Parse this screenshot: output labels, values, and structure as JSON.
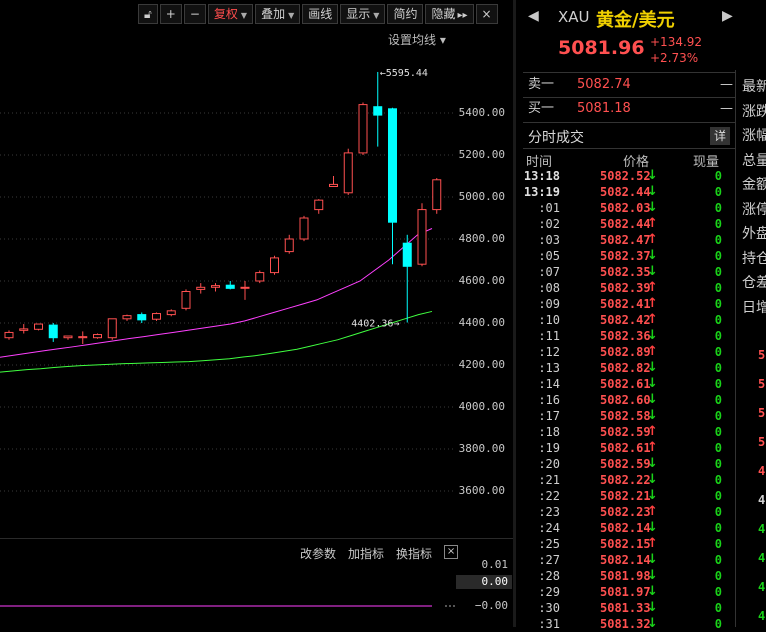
{
  "toolbar": {
    "lock_icon": "lock-icon",
    "plus_label": "+",
    "minus_label": "−",
    "fuquan": "复权",
    "diejia": "叠加",
    "huaxian": "画线",
    "xianshi": "显示",
    "jianyue": "简约",
    "yincang": "隐藏",
    "more": "▸▸",
    "close": "×",
    "active_color": "#ff4d4d"
  },
  "chart": {
    "settings_ma": "设置均线 ▾",
    "high_label": "←5595.44",
    "low_label": "4402.36→",
    "y_ticks": [
      "5400.00",
      "5200.00",
      "5000.00",
      "4800.00",
      "4600.00",
      "4400.00",
      "4200.00",
      "4000.00",
      "3800.00",
      "3600.00"
    ],
    "colors": {
      "up": "#ff5050",
      "down": "#00ffff",
      "ma_short": "#ff40ff",
      "ma_long": "#40ff40"
    }
  },
  "chart_data": {
    "type": "candlestick",
    "y_ticks": [
      5400,
      5200,
      5000,
      4800,
      4600,
      4400,
      4200,
      4000,
      3800,
      3600
    ],
    "candles": [
      {
        "o": 4330,
        "h": 4365,
        "l": 4320,
        "c": 4355
      },
      {
        "o": 4365,
        "h": 4395,
        "l": 4350,
        "c": 4372
      },
      {
        "o": 4370,
        "h": 4395,
        "l": 4365,
        "c": 4395
      },
      {
        "o": 4390,
        "h": 4400,
        "l": 4310,
        "c": 4330
      },
      {
        "o": 4330,
        "h": 4340,
        "l": 4320,
        "c": 4338
      },
      {
        "o": 4330,
        "h": 4360,
        "l": 4300,
        "c": 4335
      },
      {
        "o": 4330,
        "h": 4350,
        "l": 4325,
        "c": 4345
      },
      {
        "o": 4330,
        "h": 4380,
        "l": 4320,
        "c": 4420
      },
      {
        "o": 4420,
        "h": 4440,
        "l": 4410,
        "c": 4435
      },
      {
        "o": 4440,
        "h": 4450,
        "l": 4400,
        "c": 4415
      },
      {
        "o": 4418,
        "h": 4450,
        "l": 4410,
        "c": 4445
      },
      {
        "o": 4440,
        "h": 4465,
        "l": 4432,
        "c": 4458
      },
      {
        "o": 4470,
        "h": 4560,
        "l": 4460,
        "c": 4550
      },
      {
        "o": 4560,
        "h": 4590,
        "l": 4540,
        "c": 4570
      },
      {
        "o": 4570,
        "h": 4590,
        "l": 4550,
        "c": 4578
      },
      {
        "o": 4580,
        "h": 4600,
        "l": 4560,
        "c": 4565
      },
      {
        "o": 4570,
        "h": 4600,
        "l": 4510,
        "c": 4570
      },
      {
        "o": 4600,
        "h": 4650,
        "l": 4590,
        "c": 4640
      },
      {
        "o": 4640,
        "h": 4720,
        "l": 4630,
        "c": 4710
      },
      {
        "o": 4740,
        "h": 4820,
        "l": 4730,
        "c": 4800
      },
      {
        "o": 4800,
        "h": 4910,
        "l": 4790,
        "c": 4900
      },
      {
        "o": 4940,
        "h": 4990,
        "l": 4920,
        "c": 4985
      },
      {
        "o": 5050,
        "h": 5100,
        "l": 5050,
        "c": 5060
      },
      {
        "o": 5020,
        "h": 5230,
        "l": 5010,
        "c": 5210
      },
      {
        "o": 5210,
        "h": 5450,
        "l": 5200,
        "c": 5440
      },
      {
        "o": 5430,
        "h": 5595.44,
        "l": 5240,
        "c": 5390
      },
      {
        "o": 5420,
        "h": 5425,
        "l": 4680,
        "c": 4880
      },
      {
        "o": 4780,
        "h": 4820,
        "l": 4402.36,
        "c": 4670
      },
      {
        "o": 4680,
        "h": 4970,
        "l": 4670,
        "c": 4940
      },
      {
        "o": 4940,
        "h": 5090,
        "l": 4920,
        "c": 5081.96
      }
    ],
    "ma_short": [
      4237,
      4247,
      4257,
      4267,
      4277,
      4286,
      4296,
      4306,
      4316,
      4326,
      4335,
      4345,
      4355,
      4365,
      4375,
      4385,
      4395,
      4410,
      4430,
      4450,
      4470,
      4490,
      4510,
      4540,
      4570,
      4600,
      4650,
      4700,
      4760,
      4820,
      4850
    ],
    "ma_long": [
      4166,
      4172,
      4178,
      4182,
      4188,
      4193,
      4197,
      4200,
      4203,
      4206,
      4208,
      4210,
      4212,
      4214,
      4216,
      4220,
      4225,
      4230,
      4238,
      4245,
      4255,
      4265,
      4275,
      4290,
      4305,
      4320,
      4340,
      4360,
      4380,
      4400,
      4420,
      4440,
      4455
    ],
    "indicator": {
      "labels": [
        "0.01",
        "0.00",
        "−0.00"
      ]
    }
  },
  "indicator_bar": {
    "change_params": "改参数",
    "add_indicator": "加指标",
    "switch_indicator": "换指标",
    "close": "×"
  },
  "quote": {
    "nav_left": "◀",
    "nav_right": "▶",
    "symbol": "XAU",
    "name": "黄金/美元",
    "last": "5081.96",
    "change": "+134.92",
    "change_pct": "+2.73%",
    "sell_label": "卖一",
    "sell_price": "5082.74",
    "sell_vol": "—",
    "buy_label": "买一",
    "buy_price": "5081.18",
    "buy_vol": "—",
    "ticks_title": "分时成交",
    "detail": "详",
    "col_time": "时间",
    "col_price": "价格",
    "col_vol": "现量"
  },
  "ticks": [
    {
      "t": "13:18",
      "p": "5082.52",
      "d": "down",
      "v": "0",
      "big": true
    },
    {
      "t": "13:19",
      "p": "5082.44",
      "d": "down",
      "v": "0",
      "big": true
    },
    {
      "t": ":01",
      "p": "5082.03",
      "d": "down",
      "v": "0"
    },
    {
      "t": ":02",
      "p": "5082.44",
      "d": "up",
      "v": "0"
    },
    {
      "t": ":03",
      "p": "5082.47",
      "d": "up",
      "v": "0"
    },
    {
      "t": ":05",
      "p": "5082.37",
      "d": "down",
      "v": "0"
    },
    {
      "t": ":07",
      "p": "5082.35",
      "d": "down",
      "v": "0"
    },
    {
      "t": ":08",
      "p": "5082.39",
      "d": "up",
      "v": "0"
    },
    {
      "t": ":09",
      "p": "5082.41",
      "d": "up",
      "v": "0"
    },
    {
      "t": ":10",
      "p": "5082.42",
      "d": "up",
      "v": "0"
    },
    {
      "t": ":11",
      "p": "5082.36",
      "d": "down",
      "v": "0"
    },
    {
      "t": ":12",
      "p": "5082.89",
      "d": "up",
      "v": "0"
    },
    {
      "t": ":13",
      "p": "5082.82",
      "d": "down",
      "v": "0"
    },
    {
      "t": ":14",
      "p": "5082.61",
      "d": "down",
      "v": "0"
    },
    {
      "t": ":16",
      "p": "5082.60",
      "d": "down",
      "v": "0"
    },
    {
      "t": ":17",
      "p": "5082.58",
      "d": "down",
      "v": "0"
    },
    {
      "t": ":18",
      "p": "5082.59",
      "d": "up",
      "v": "0"
    },
    {
      "t": ":19",
      "p": "5082.61",
      "d": "up",
      "v": "0"
    },
    {
      "t": ":20",
      "p": "5082.59",
      "d": "down",
      "v": "0"
    },
    {
      "t": ":21",
      "p": "5082.22",
      "d": "down",
      "v": "0"
    },
    {
      "t": ":22",
      "p": "5082.21",
      "d": "down",
      "v": "0"
    },
    {
      "t": ":23",
      "p": "5082.23",
      "d": "up",
      "v": "0"
    },
    {
      "t": ":24",
      "p": "5082.14",
      "d": "down",
      "v": "0"
    },
    {
      "t": ":25",
      "p": "5082.15",
      "d": "up",
      "v": "0"
    },
    {
      "t": ":27",
      "p": "5082.14",
      "d": "down",
      "v": "0"
    },
    {
      "t": ":28",
      "p": "5081.98",
      "d": "down",
      "v": "0"
    },
    {
      "t": ":29",
      "p": "5081.97",
      "d": "down",
      "v": "0"
    },
    {
      "t": ":30",
      "p": "5081.33",
      "d": "down",
      "v": "0"
    },
    {
      "t": ":31",
      "p": "5081.32",
      "d": "down",
      "v": "0"
    }
  ],
  "side": {
    "labels": [
      "最新",
      "涨跌",
      "涨幅",
      "总量",
      "金额",
      "涨停",
      "外盘",
      "持仓",
      "仓差",
      "日增"
    ],
    "nums": [
      {
        "v": "5",
        "c": "#ff5050"
      },
      {
        "v": "5",
        "c": "#ff5050"
      },
      {
        "v": "5",
        "c": "#ff5050"
      },
      {
        "v": "5",
        "c": "#ff5050"
      },
      {
        "v": "4",
        "c": "#ff5050"
      },
      {
        "v": "4",
        "c": "#cfcfcf"
      },
      {
        "v": "4",
        "c": "#19d219"
      },
      {
        "v": "4",
        "c": "#19d219"
      },
      {
        "v": "4",
        "c": "#19d219"
      },
      {
        "v": "4",
        "c": "#19d219"
      }
    ]
  }
}
